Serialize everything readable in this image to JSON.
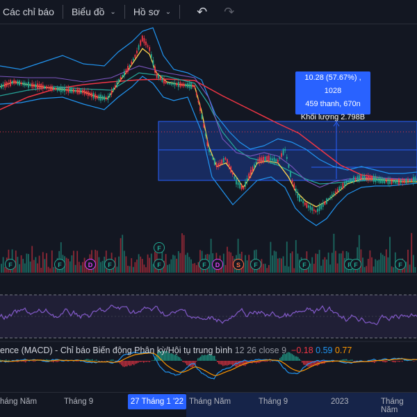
{
  "toolbar": {
    "indicators_label": "Các chỉ báo",
    "chart_label": "Biểu đồ",
    "profile_label": "Hồ sơ"
  },
  "measure_tooltip": {
    "line1": "10.28 (57.67%) , 1028",
    "line2": "459 thanh, 670n",
    "line3": "Khối lượng 2.798B"
  },
  "macd": {
    "label": "ence (MACD) - Chỉ báo Biến động Phân kỳ/Hội tụ trung bình",
    "params": "12 26 close 9",
    "hist_value": "−0.18",
    "macd_value": "0.59",
    "signal_value": "0.77"
  },
  "xaxis": {
    "labels": [
      "háng Năm",
      "Tháng 9",
      "Tháng Năm",
      "Tháng 9",
      "2023",
      "Tháng Năm"
    ],
    "highlight": "27 Tháng 1 '22"
  },
  "events": {
    "f": "F",
    "d": "D",
    "s": "S"
  },
  "colors": {
    "background": "#131722",
    "accent": "#2962ff",
    "up": "#22ab94",
    "down": "#f23645",
    "rsi": "#7e57c2"
  }
}
